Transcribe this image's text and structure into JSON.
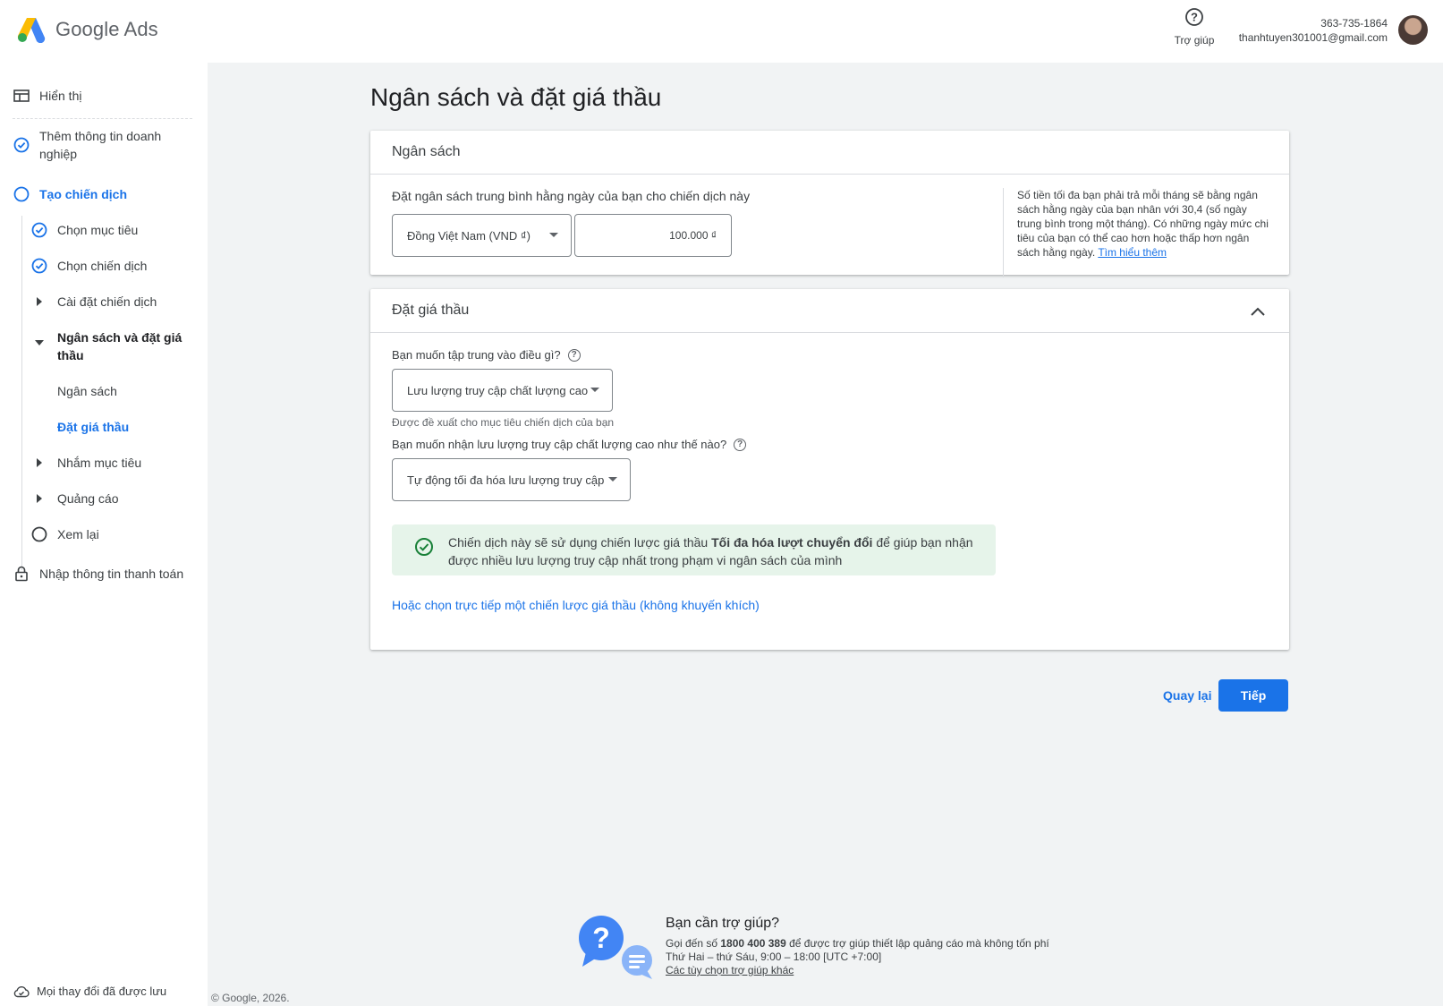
{
  "header": {
    "logo_text": "Google Ads",
    "help_label": "Trợ giúp",
    "phone": "363-735-1864",
    "email": "thanhtuyen301001@gmail.com",
    "accent": "#1a73e8"
  },
  "sidebar": {
    "items": [
      {
        "label": "Hiển thị",
        "icon": "layout-icon"
      },
      {
        "label": "Thêm thông tin doanh nghiệp",
        "icon": "check-circle-icon"
      },
      {
        "label": "Tạo chiến dịch",
        "icon": "circle-icon"
      },
      {
        "label": "Chọn mục tiêu",
        "icon": "check-circle-icon"
      },
      {
        "label": "Chọn chiến dịch",
        "icon": "check-circle-icon"
      },
      {
        "label": "Cài đặt chiến dịch",
        "icon": "triangle-right-icon"
      },
      {
        "label": "Ngân sách và đặt giá thầu",
        "icon": "triangle-down-icon"
      },
      {
        "label": "Ngân sách"
      },
      {
        "label": "Đặt giá thầu"
      },
      {
        "label": "Nhắm mục tiêu",
        "icon": "triangle-right-icon"
      },
      {
        "label": "Quảng cáo",
        "icon": "triangle-right-icon"
      },
      {
        "label": "Xem lại",
        "icon": "circle-icon"
      },
      {
        "label": "Nhập thông tin thanh toán",
        "icon": "lock-icon"
      }
    ],
    "saved_status": "Mọi thay đổi đã được lưu"
  },
  "main": {
    "page_title": "Ngân sách và đặt giá thầu",
    "budget": {
      "title": "Ngân sách",
      "prompt": "Đặt ngân sách trung bình hằng ngày của bạn cho chiến dịch này",
      "currency": "Đồng Việt Nam (VND ₫)",
      "amount": "100.000 ₫",
      "note": "Số tiền tối đa bạn phải trả mỗi tháng sẽ bằng ngân sách hằng ngày của bạn nhân với 30,4 (số ngày trung bình trong một tháng). Có những ngày mức chi tiêu của bạn có thể cao hơn hoặc thấp hơn ngân sách hằng ngày.",
      "learn_more": "Tìm hiểu thêm"
    },
    "bidding": {
      "title": "Đặt giá thầu",
      "focus_question": "Bạn muốn tập trung vào điều gì?",
      "focus_value": "Lưu lượng truy cập chất lượng cao",
      "focus_hint": "Được đề xuất cho mục tiêu chiến dịch của bạn",
      "how_question": "Bạn muốn nhận lưu lượng truy cập chất lượng cao như thế nào?",
      "how_value": "Tự động tối đa hóa lưu lượng truy cập",
      "info_prefix": "Chiến dịch này sẽ sử dụng chiến lược giá thầu ",
      "info_strategy": "Tối đa hóa lượt chuyển đổi",
      "info_suffix": " để giúp bạn nhận được nhiều lưu lượng truy cập nhất trong phạm vi ngân sách của mình",
      "direct_link": "Hoặc chọn trực tiếp một chiến lược giá thầu (không khuyến khích)"
    },
    "back_label": "Quay lại",
    "next_label": "Tiếp"
  },
  "help_footer": {
    "title": "Bạn cần trợ giúp?",
    "line1_prefix": "Gọi đến số ",
    "phone": "1800 400 389",
    "line1_suffix": " để được trợ giúp thiết lập quảng cáo mà không tốn phí",
    "hours": "Thứ Hai – thứ Sáu, 9:00 – 18:00 [UTC +7:00]",
    "other_options": "Các tùy chọn trợ giúp khác"
  },
  "copyright": "© Google, 2026."
}
